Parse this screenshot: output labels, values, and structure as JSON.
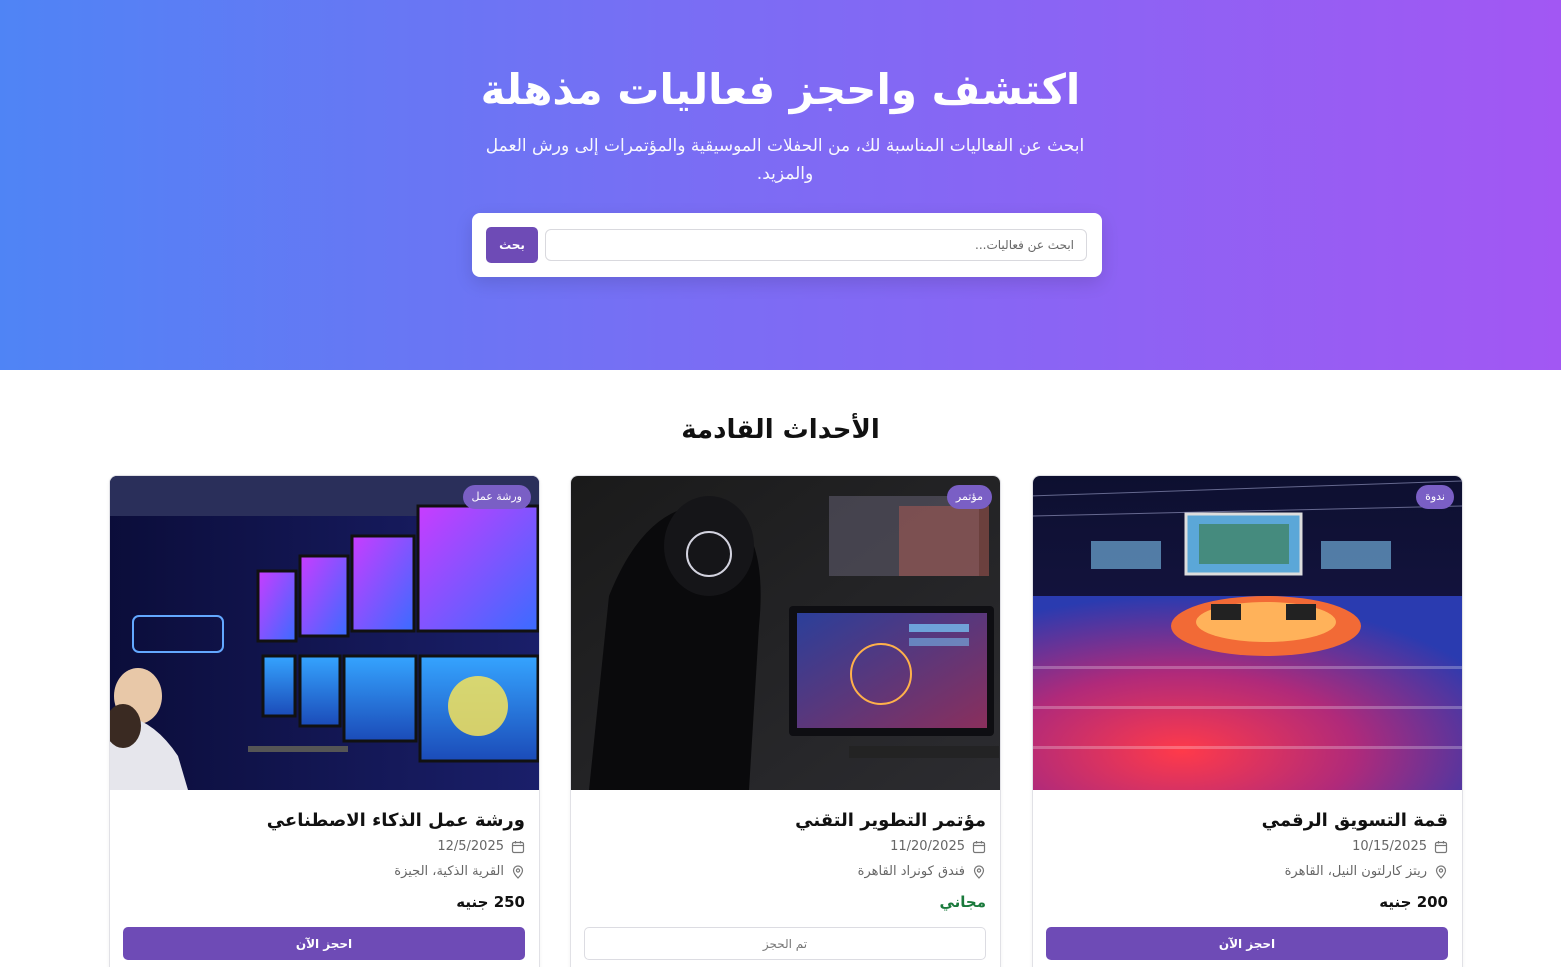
{
  "hero": {
    "title": "اكتشف واحجز فعاليات مذهلة",
    "subtitle": "ابحث عن الفعاليات المناسبة لك، من الحفلات الموسيقية والمؤتمرات إلى ورش العمل والمزيد.",
    "search_placeholder": "ابحث عن فعاليات...",
    "search_button": "بحث"
  },
  "section": {
    "title": "الأحداث القادمة"
  },
  "events": [
    {
      "badge": "ندوة",
      "title": "قمة التسويق الرقمي",
      "date": "10/15/2025",
      "location": "ريتز كارلتون النيل، القاهرة",
      "price": "200 جنيه",
      "button": "احجز الآن",
      "booked": false
    },
    {
      "badge": "مؤتمر",
      "title": "مؤتمر التطوير التقني",
      "date": "11/20/2025",
      "location": "فندق كونراد القاهرة",
      "price": "مجاني",
      "button": "تم الحجز",
      "booked": true
    },
    {
      "badge": "ورشة عمل",
      "title": "ورشة عمل الذكاء الاصطناعي",
      "date": "12/5/2025",
      "location": "القرية الذكية، الجيزة",
      "price": "250 جنيه",
      "button": "احجز الآن",
      "booked": false
    }
  ],
  "colors": {
    "accent": "#6e4bb6",
    "hero_left": "#4f84f5",
    "hero_right": "#a257f3",
    "free_price": "#1a7a3c"
  },
  "icons": {
    "date": "calendar-icon",
    "location": "map-pin-icon"
  }
}
